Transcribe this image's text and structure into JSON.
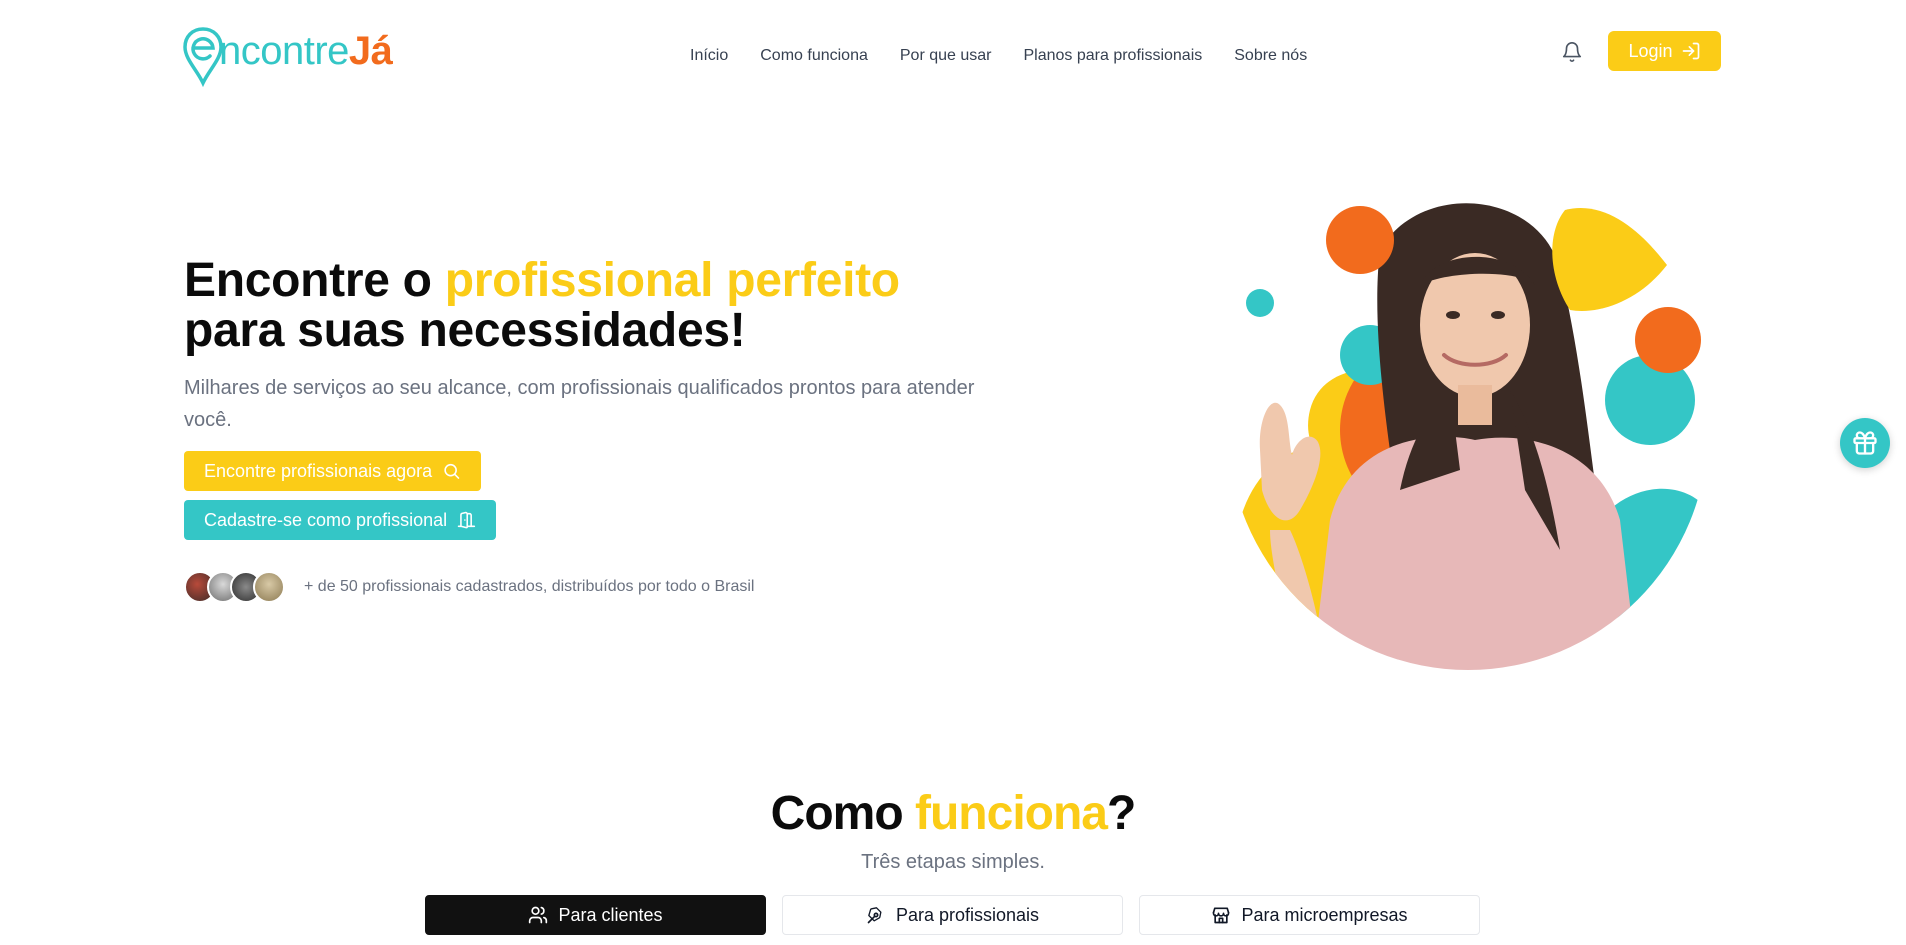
{
  "brand": {
    "part1": "ncontre",
    "part2": "Já",
    "colors": {
      "teal": "#34c6c6",
      "orange": "#f26b1d",
      "yellow": "#fbcc17"
    }
  },
  "nav": {
    "items": [
      "Início",
      "Como funciona",
      "Por que usar",
      "Planos para profissionais",
      "Sobre nós"
    ]
  },
  "header": {
    "notification_icon": "bell-icon",
    "login_label": "Login",
    "login_icon": "login-arrow-icon"
  },
  "hero": {
    "title_part1": "Encontre o ",
    "title_highlight": "profissional perfeito",
    "title_part2": "para suas necessidades!",
    "subtitle": "Milhares de serviços ao seu alcance, com profissionais qualificados prontos para atender você.",
    "cta_primary": "Encontre profissionais agora",
    "cta_primary_icon": "search-icon",
    "cta_secondary": "Cadastre-se como profissional",
    "cta_secondary_icon": "door-icon",
    "social_proof": "+ de 50 profissionais cadastrados, distribuídos por todo o Brasil"
  },
  "floating": {
    "gift_icon": "gift-icon"
  },
  "how_it_works": {
    "title_part1": "Como ",
    "title_highlight": "funciona",
    "title_part2": "?",
    "subtitle": "Três etapas simples.",
    "tabs": [
      {
        "label": "Para clientes",
        "icon": "users-icon",
        "active": true
      },
      {
        "label": "Para profissionais",
        "icon": "pen-tool-icon",
        "active": false
      },
      {
        "label": "Para microempresas",
        "icon": "store-icon",
        "active": false
      }
    ]
  }
}
